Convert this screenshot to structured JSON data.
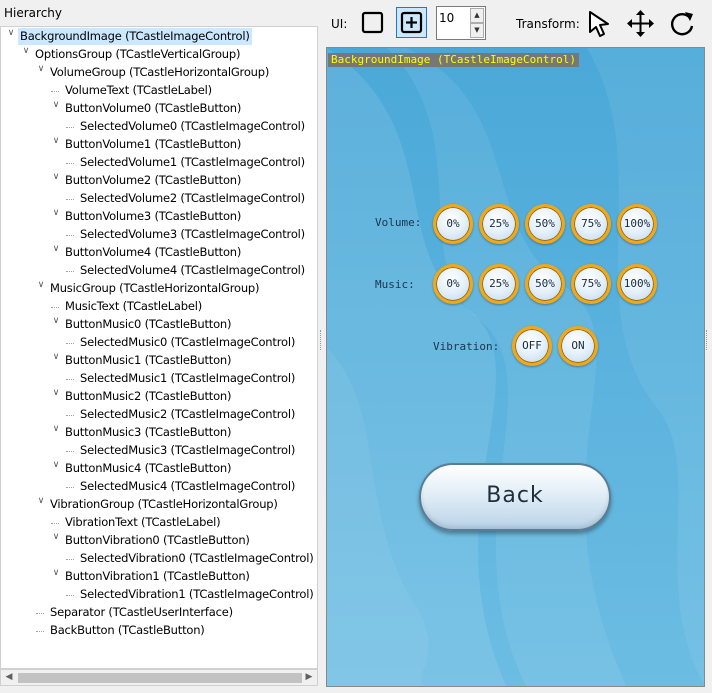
{
  "hierarchy": {
    "title": "Hierarchy",
    "nodes": [
      {
        "text": "BackgroundImage (TCastleImageControl)",
        "level": 0,
        "expanded": true,
        "selected": true
      },
      {
        "text": "OptionsGroup (TCastleVerticalGroup)",
        "level": 1,
        "expanded": true
      },
      {
        "text": "VolumeGroup (TCastleHorizontalGroup)",
        "level": 2,
        "expanded": true
      },
      {
        "text": "VolumeText (TCastleLabel)",
        "level": 3
      },
      {
        "text": "ButtonVolume0 (TCastleButton)",
        "level": 3,
        "expanded": true
      },
      {
        "text": "SelectedVolume0 (TCastleImageControl)",
        "level": 4
      },
      {
        "text": "ButtonVolume1 (TCastleButton)",
        "level": 3,
        "expanded": true
      },
      {
        "text": "SelectedVolume1 (TCastleImageControl)",
        "level": 4
      },
      {
        "text": "ButtonVolume2 (TCastleButton)",
        "level": 3,
        "expanded": true
      },
      {
        "text": "SelectedVolume2 (TCastleImageControl)",
        "level": 4
      },
      {
        "text": "ButtonVolume3 (TCastleButton)",
        "level": 3,
        "expanded": true
      },
      {
        "text": "SelectedVolume3 (TCastleImageControl)",
        "level": 4
      },
      {
        "text": "ButtonVolume4 (TCastleButton)",
        "level": 3,
        "expanded": true
      },
      {
        "text": "SelectedVolume4 (TCastleImageControl)",
        "level": 4
      },
      {
        "text": "MusicGroup (TCastleHorizontalGroup)",
        "level": 2,
        "expanded": true
      },
      {
        "text": "MusicText (TCastleLabel)",
        "level": 3
      },
      {
        "text": "ButtonMusic0 (TCastleButton)",
        "level": 3,
        "expanded": true
      },
      {
        "text": "SelectedMusic0 (TCastleImageControl)",
        "level": 4
      },
      {
        "text": "ButtonMusic1 (TCastleButton)",
        "level": 3,
        "expanded": true
      },
      {
        "text": "SelectedMusic1 (TCastleImageControl)",
        "level": 4
      },
      {
        "text": "ButtonMusic2 (TCastleButton)",
        "level": 3,
        "expanded": true
      },
      {
        "text": "SelectedMusic2 (TCastleImageControl)",
        "level": 4
      },
      {
        "text": "ButtonMusic3 (TCastleButton)",
        "level": 3,
        "expanded": true
      },
      {
        "text": "SelectedMusic3 (TCastleImageControl)",
        "level": 4
      },
      {
        "text": "ButtonMusic4 (TCastleButton)",
        "level": 3,
        "expanded": true
      },
      {
        "text": "SelectedMusic4 (TCastleImageControl)",
        "level": 4
      },
      {
        "text": "VibrationGroup (TCastleHorizontalGroup)",
        "level": 2,
        "expanded": true
      },
      {
        "text": "VibrationText (TCastleLabel)",
        "level": 3
      },
      {
        "text": "ButtonVibration0 (TCastleButton)",
        "level": 3,
        "expanded": true
      },
      {
        "text": "SelectedVibration0 (TCastleImageControl)",
        "level": 4
      },
      {
        "text": "ButtonVibration1 (TCastleButton)",
        "level": 3,
        "expanded": true
      },
      {
        "text": "SelectedVibration1 (TCastleImageControl)",
        "level": 4
      },
      {
        "text": "Separator (TCastleUserInterface)",
        "level": 2
      },
      {
        "text": "BackButton (TCastleButton)",
        "level": 2
      }
    ]
  },
  "toolbar": {
    "ui_label": "UI:",
    "spin_value": "10",
    "transform_label": "Transform:"
  },
  "preview": {
    "selected_label": "BackgroundImage (TCastleImageControl)",
    "volume_label": "Volume:",
    "volume_buttons": [
      "0%",
      "25%",
      "50%",
      "75%",
      "100%"
    ],
    "music_label": "Music:",
    "music_buttons": [
      "0%",
      "25%",
      "50%",
      "75%",
      "100%"
    ],
    "vibration_label": "Vibration:",
    "vibration_buttons": [
      "OFF",
      "ON"
    ],
    "back_label": "Back"
  },
  "colors": {
    "selection": "#cce8ff",
    "preview_bg": "#5fb0dc",
    "button_ring": "#f0a818",
    "label_bg": "#777777",
    "label_text": "#ffff00"
  }
}
